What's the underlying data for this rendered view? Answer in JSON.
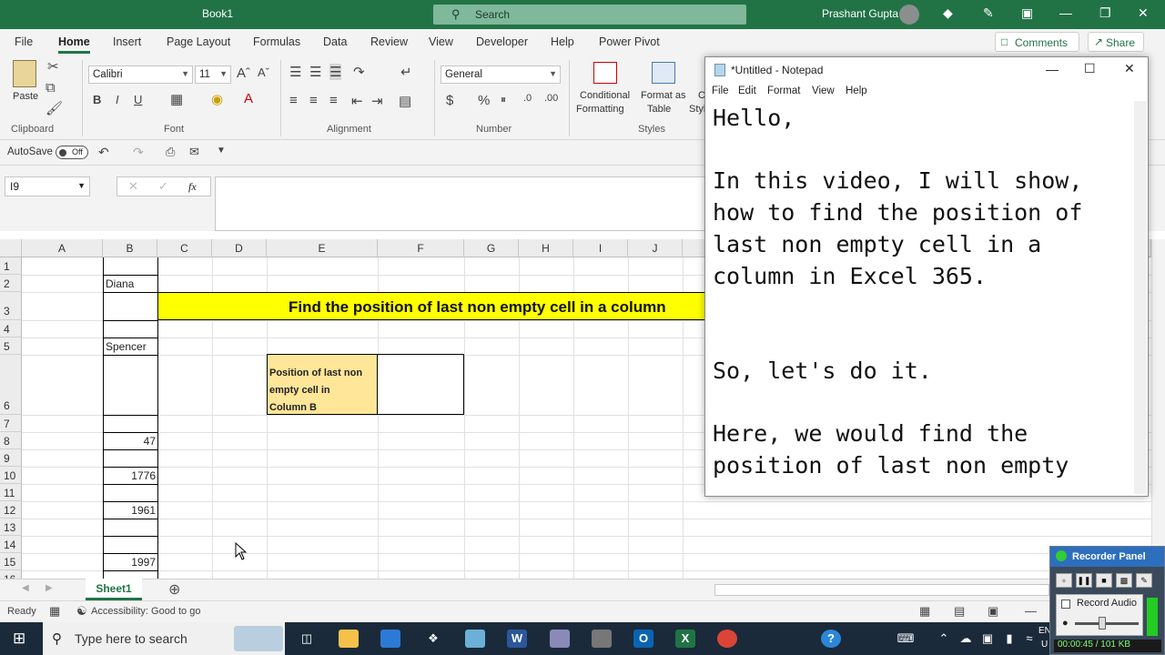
{
  "titlebar": {
    "doc_title": "Book1",
    "search_placeholder": "Search",
    "user_name": "Prashant Gupta"
  },
  "menu": {
    "tabs": [
      "File",
      "Home",
      "Insert",
      "Page Layout",
      "Formulas",
      "Data",
      "Review",
      "View",
      "Developer",
      "Help",
      "Power Pivot"
    ],
    "active": "Home",
    "comments": "Comments",
    "share": "Share"
  },
  "ribbon": {
    "paste": "Paste",
    "font_name": "Calibri",
    "font_size": "11",
    "number_format": "General",
    "conditional": "Conditional",
    "formatting": "Formatting",
    "format_as": "Format as",
    "table": "Table",
    "cell_styles_partial": "C",
    "cell_styles_partial2": "Styl",
    "groups": [
      "Clipboard",
      "Font",
      "Alignment",
      "Number",
      "Styles"
    ]
  },
  "qat": {
    "autosave": "AutoSave",
    "toggle": "Off"
  },
  "formula_bar": {
    "name_box": "I9",
    "fx": "fx"
  },
  "grid": {
    "columns": [
      "A",
      "B",
      "C",
      "D",
      "E",
      "F",
      "G",
      "H",
      "I",
      "J"
    ],
    "rows": [
      "1",
      "2",
      "3",
      "4",
      "5",
      "6",
      "7",
      "8",
      "9",
      "10",
      "11",
      "12",
      "13",
      "14",
      "15",
      "16"
    ],
    "b2": "Diana",
    "b5": "Spencer",
    "b8": "47",
    "b10": "1776",
    "b12": "1961",
    "b15": "1997",
    "heading": "Find the position of last non empty cell in a column",
    "label_line1": "Position of last non",
    "label_line2": "empty cell in",
    "label_line3": "Column B"
  },
  "sheet_tabs": {
    "sheet1": "Sheet1"
  },
  "status": {
    "ready": "Ready",
    "accessibility": "Accessibility: Good to go"
  },
  "notepad": {
    "title": "*Untitled - Notepad",
    "menu": [
      "File",
      "Edit",
      "Format",
      "View",
      "Help"
    ],
    "text": "Hello,\n\nIn this video, I will show,\nhow to find the position of\nlast non empty cell in a\ncolumn in Excel 365.\n\n\nSo, let's do it.\n\nHere, we would find the\nposition of last non empty"
  },
  "taskbar": {
    "search_placeholder": "Type here to search",
    "lang1": "EN",
    "lang2": "U"
  },
  "recorder": {
    "title": "Recorder Panel",
    "record_audio": "Record Audio",
    "time": "00:00:45 / 101 KB"
  },
  "colors": {
    "excel_green": "#217346",
    "heading_yellow": "#ffff00",
    "label_fill": "#ffe699"
  }
}
